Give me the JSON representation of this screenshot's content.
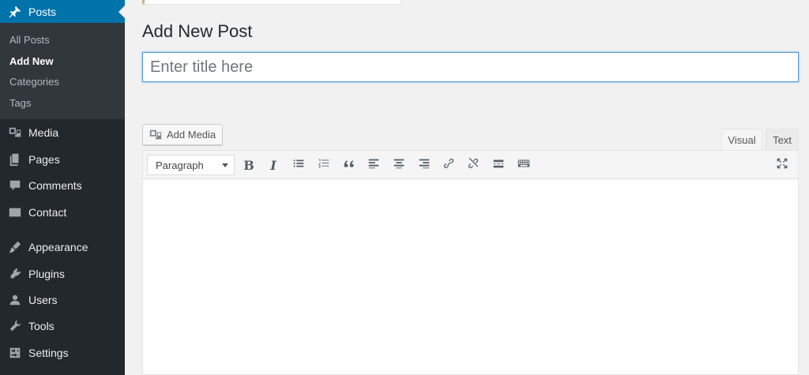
{
  "sidebar": {
    "current": {
      "label": "Posts",
      "icon": "pin-icon"
    },
    "submenu": [
      {
        "label": "All Posts",
        "active": false
      },
      {
        "label": "Add New",
        "active": true
      },
      {
        "label": "Categories",
        "active": false
      },
      {
        "label": "Tags",
        "active": false
      }
    ],
    "items": [
      {
        "label": "Media",
        "icon": "media-icon"
      },
      {
        "label": "Pages",
        "icon": "pages-icon"
      },
      {
        "label": "Comments",
        "icon": "comments-icon"
      },
      {
        "label": "Contact",
        "icon": "mail-icon"
      },
      {
        "label": "Appearance",
        "icon": "paintbrush-icon"
      },
      {
        "label": "Plugins",
        "icon": "plugin-icon"
      },
      {
        "label": "Users",
        "icon": "user-icon"
      },
      {
        "label": "Tools",
        "icon": "wrench-icon"
      },
      {
        "label": "Settings",
        "icon": "settings-icon"
      }
    ]
  },
  "main": {
    "page_title": "Add New Post",
    "title_placeholder": "Enter title here",
    "add_media_label": "Add Media",
    "tabs": {
      "visual": "Visual",
      "text": "Text"
    },
    "format_select": "Paragraph",
    "toolbar_buttons": [
      "bold-icon",
      "italic-icon",
      "bulleted-list-icon",
      "numbered-list-icon",
      "blockquote-icon",
      "align-left-icon",
      "align-center-icon",
      "align-right-icon",
      "link-icon",
      "unlink-icon",
      "read-more-icon",
      "toolbar-toggle-icon",
      "fullscreen-icon"
    ]
  },
  "colors": {
    "sidebar_bg": "#23282d",
    "submenu_bg": "#32373c",
    "accent": "#0073aa",
    "page_bg": "#f1f1f1"
  }
}
